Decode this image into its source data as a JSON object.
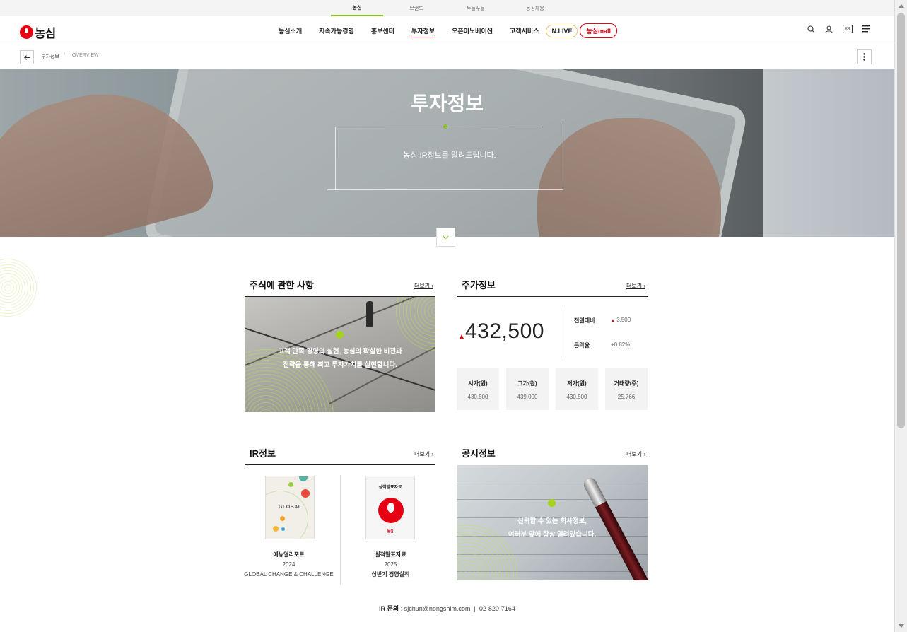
{
  "top_tabs": [
    "농심",
    "브랜드",
    "누들푸들",
    "농심채용"
  ],
  "header": {
    "logo_text": "농심",
    "nav": [
      "농심소개",
      "지속가능경영",
      "홍보센터",
      "투자정보",
      "오픈이노베이션",
      "고객서비스"
    ],
    "nlive_label": "N.LIVE",
    "mall_label": "농심mall",
    "icons": [
      "search-icon",
      "user-icon",
      "language-icon",
      "menu-icon"
    ],
    "language_badge": "KR"
  },
  "breadcrumb": {
    "current": "투자정보",
    "separator": "/",
    "page": "OVERVIEW"
  },
  "hero": {
    "title": "투자정보",
    "subtitle": "농심 IR정보를 알려드립니다."
  },
  "stock_section": {
    "title": "주식에 관한 사항",
    "more": "더보기",
    "caption_line1": "고객 만족 경영의 실현, 농심의 확실한 비전과",
    "caption_line2": "전략을 통해 최고 투자가치를 실현합니다."
  },
  "price_section": {
    "title": "주가정보",
    "more": "더보기",
    "price": "432,500",
    "change_label": "전일대비",
    "change_value": "3,500",
    "rate_label": "등락율",
    "rate_value": "+0.82%",
    "boxes": [
      {
        "label": "시가(원)",
        "value": "430,500"
      },
      {
        "label": "고가(원)",
        "value": "439,000"
      },
      {
        "label": "저가(원)",
        "value": "430,500"
      },
      {
        "label": "거래량(주)",
        "value": "25,766"
      }
    ]
  },
  "ir_section": {
    "title": "IR정보",
    "more": "더보기",
    "book1": {
      "cover_title": "GLOBAL",
      "name": "애뉴얼리포트",
      "year": "2024",
      "desc": "GLOBAL CHANGE & CHALLENGE"
    },
    "book2": {
      "cover_title": "실적발표자료",
      "cover_logo": "농심",
      "name": "실적발표자료",
      "year": "2025",
      "desc": "상반기 경영실적"
    }
  },
  "disclosure_section": {
    "title": "공시정보",
    "more": "더보기",
    "caption_line1": "신뢰할 수 있는 회사정보,",
    "caption_line2": "여러분 앞에 항상 열려있습니다."
  },
  "contact": {
    "label": "IR 문의",
    "colon": ":",
    "email": "sjchun@nongshim.com",
    "divider": "|",
    "phone": "02-820-7164"
  },
  "colors": {
    "brand_red": "#e60012",
    "accent_green": "#8cbf26"
  }
}
